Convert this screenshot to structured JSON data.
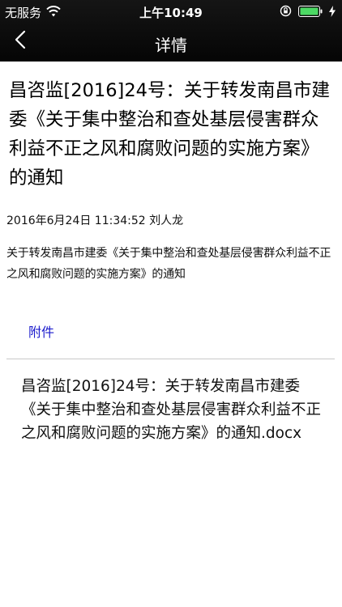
{
  "status_bar": {
    "carrier": "无服务",
    "time": "上午10:49",
    "icons": [
      "wifi-icon",
      "orientation-lock-icon",
      "battery-icon",
      "charging-icon"
    ]
  },
  "nav": {
    "back_icon": "chevron-left-icon",
    "title": "详情"
  },
  "article": {
    "title": "昌咨监[2016]24号：关于转发南昌市建委《关于集中整治和查处基层侵害群众利益不正之风和腐败问题的实施方案》的通知",
    "meta": "2016年6月24日 11:34:52 刘人龙",
    "summary": "关于转发南昌市建委《关于集中整治和查处基层侵害群众利益不正之风和腐败问题的实施方案》的通知"
  },
  "attachments": {
    "label": "附件",
    "items": [
      {
        "name": "昌咨监[2016]24号：关于转发南昌市建委《关于集中整治和查处基层侵害群众利益不正之风和腐败问题的实施方案》的通知.docx"
      }
    ]
  },
  "colors": {
    "topbar": "#0b0b0b",
    "battery": "#4cd964",
    "link_blue": "#1a1acc",
    "divider": "#c8c8c8"
  }
}
